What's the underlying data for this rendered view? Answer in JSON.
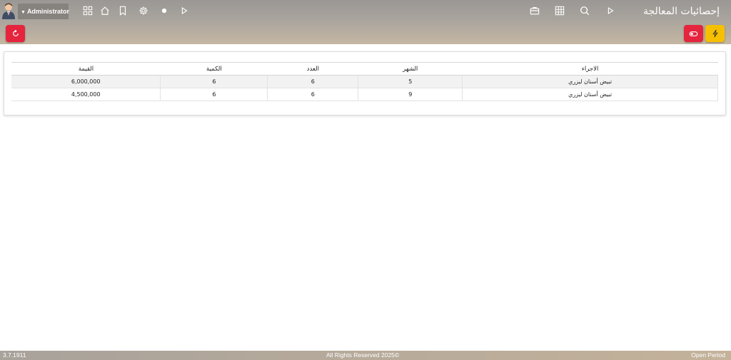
{
  "header": {
    "title": "إحصائيات المعالجة",
    "user_label": "Administrator",
    "icons_right": [
      "briefcase-icon",
      "grid-icon",
      "search-icon",
      "play-icon"
    ],
    "icons_left": [
      "apps-icon",
      "home-icon",
      "bookmark-icon",
      "gear-icon",
      "dot-icon",
      "play-icon"
    ]
  },
  "actions": {
    "refresh_icon": "refresh-icon",
    "toggle_icon": "toggle-icon",
    "flash_icon": "lightning-icon"
  },
  "table": {
    "columns": [
      "الاجراء",
      "الشهر",
      "العدد",
      "الكمية",
      "القيمة"
    ],
    "rows": [
      [
        "تبيض أسنان ليزري",
        "5",
        "6",
        "6",
        "6,000,000"
      ],
      [
        "تبيض أسنان ليزري",
        "9",
        "6",
        "6",
        "4,500,000"
      ]
    ]
  },
  "footer": {
    "version": "3.7.1911",
    "copyright": "All Rights Reserved 2025©",
    "period": "Open Period"
  },
  "colors": {
    "accent_red": "#e5243e",
    "accent_yellow": "#f6c000"
  }
}
